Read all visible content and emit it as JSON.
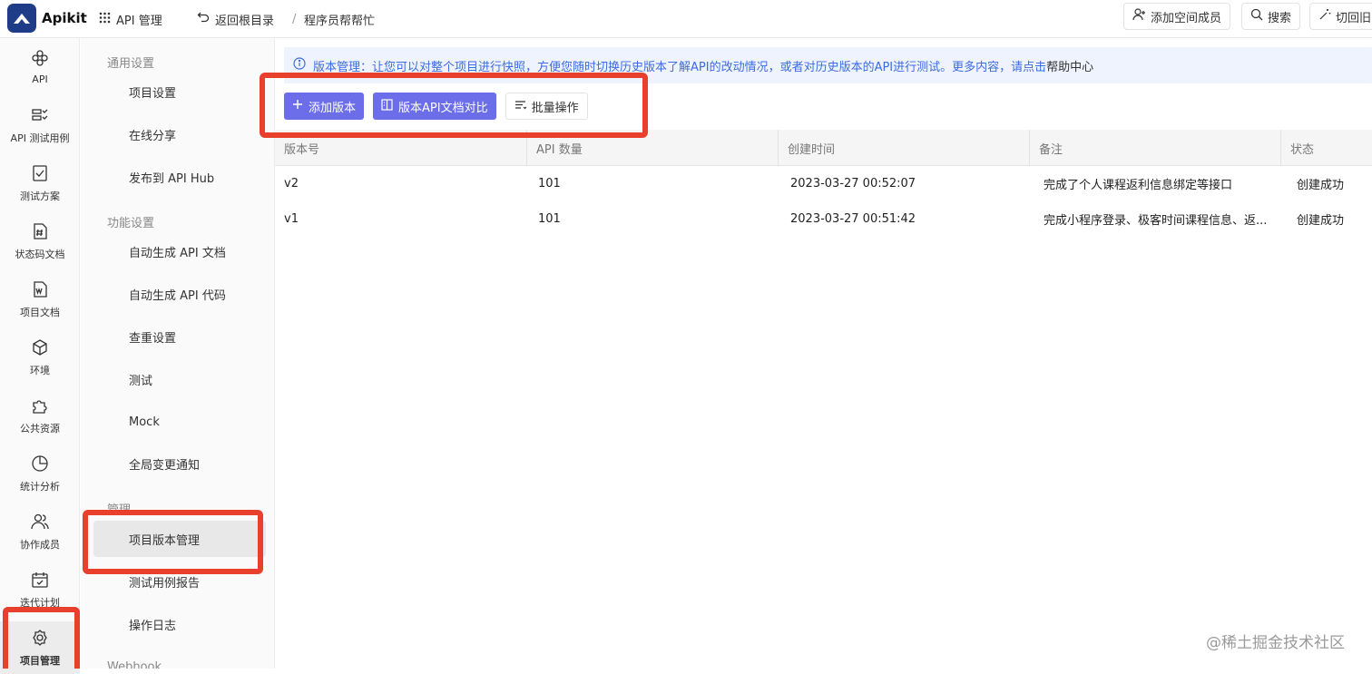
{
  "topbar": {
    "app_name": "Apikit",
    "api_manage": "API 管理",
    "back_root": "返回根目录",
    "separator": "/",
    "project_name": "程序员帮帮忙",
    "add_member": "添加空间成员",
    "search": "搜索",
    "switch_old": "切回旧"
  },
  "rail": [
    {
      "label": "API",
      "icon": "api-icon"
    },
    {
      "label": "API 测试用例",
      "icon": "test-case-icon"
    },
    {
      "label": "测试方案",
      "icon": "test-plan-icon"
    },
    {
      "label": "状态码文档",
      "icon": "status-code-icon"
    },
    {
      "label": "项目文档",
      "icon": "project-doc-icon"
    },
    {
      "label": "环境",
      "icon": "environment-icon"
    },
    {
      "label": "公共资源",
      "icon": "public-resource-icon"
    },
    {
      "label": "统计分析",
      "icon": "stats-icon"
    },
    {
      "label": "协作成员",
      "icon": "members-icon"
    },
    {
      "label": "迭代计划",
      "icon": "calendar-icon"
    },
    {
      "label": "项目管理",
      "icon": "gear-icon"
    }
  ],
  "subnav": {
    "group_general": "通用设置",
    "project_settings": "项目设置",
    "online_share": "在线分享",
    "publish_hub": "发布到 API Hub",
    "group_feature": "功能设置",
    "auto_gen_doc": "自动生成 API 文档",
    "auto_gen_code": "自动生成 API 代码",
    "dup_check": "查重设置",
    "test": "测试",
    "mock": "Mock",
    "global_notify": "全局变更通知",
    "group_manage": "管理",
    "version_manage": "项目版本管理",
    "test_report": "测试用例报告",
    "op_log": "操作日志",
    "group_webhook": "Webhook"
  },
  "notice": {
    "text": "版本管理：让您可以对整个项目进行快照，方便您随时切换历史版本了解API的改动情况，或者对历史版本的API进行测试。更多内容，请点击",
    "link": "帮助中心"
  },
  "actions": {
    "add_version": "添加版本",
    "compare": "版本API文档对比",
    "batch": "批量操作"
  },
  "table": {
    "headers": [
      "版本号",
      "API 数量",
      "创建时间",
      "备注",
      "状态"
    ],
    "rows": [
      [
        "v2",
        "101",
        "2023-03-27 00:52:07",
        "完成了个人课程返利信息绑定等接口",
        "创建成功"
      ],
      [
        "v1",
        "101",
        "2023-03-27 00:51:42",
        "完成小程序登录、极客时间课程信息、返...",
        "创建成功"
      ]
    ]
  },
  "watermark": "@稀土掘金技术社区",
  "colors": {
    "highlight": "#e8402c",
    "primary": "#6b6ee8",
    "notice_text": "#3d6be0",
    "brand": "#1f3c88"
  }
}
